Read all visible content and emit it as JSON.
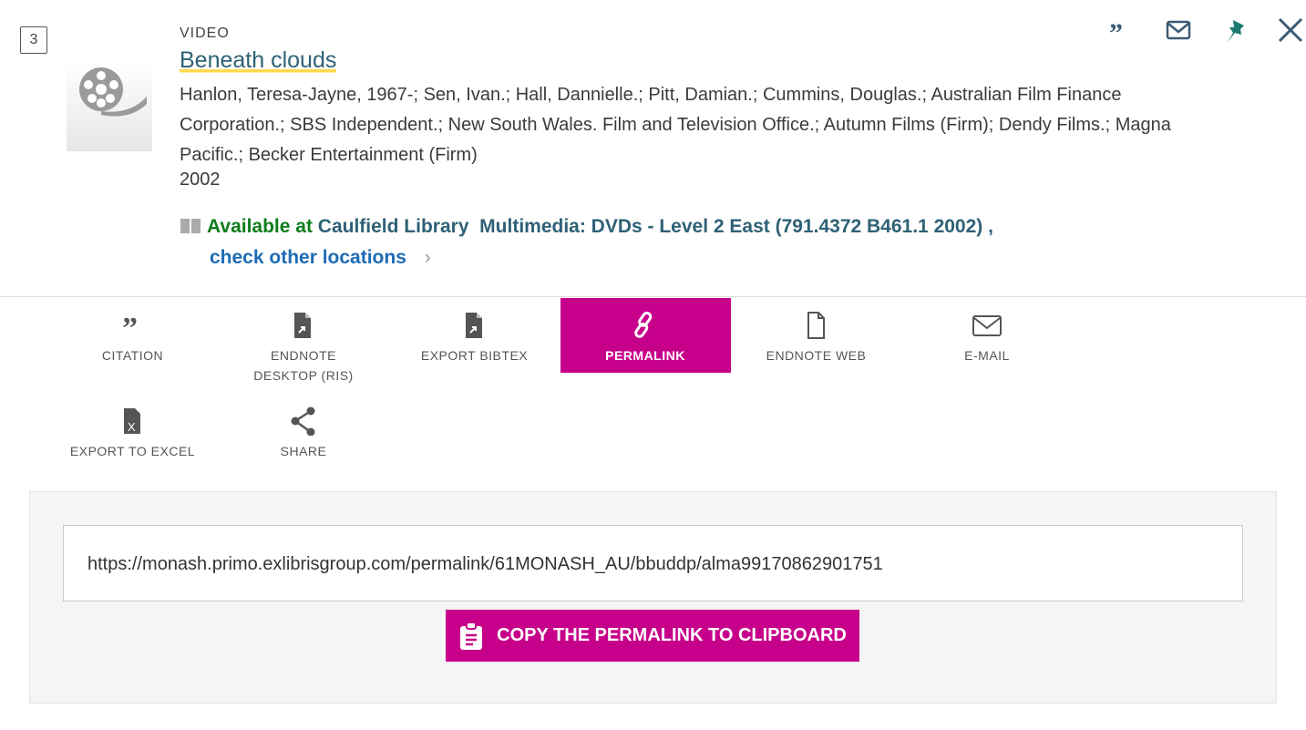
{
  "record": {
    "number": "3",
    "type": "VIDEO",
    "title": "Beneath clouds",
    "authors": "Hanlon, Teresa-Jayne, 1967-; Sen, Ivan.; Hall, Dannielle.; Pitt, Damian.; Cummins, Douglas.; Australian Film Finance Corporation.; SBS Independent.; New South Wales. Film and Television Office.; Autumn Films (Firm); Dendy Films.; Magna Pacific.; Becker Entertainment (Firm)",
    "year": "2002",
    "availability": {
      "status": "Available at",
      "library": "Caulfield Library",
      "location": "Multimedia: DVDs - Level 2 East (791.4372 B461.1 2002) ,",
      "other_locations": "check other locations"
    }
  },
  "header_icons": [
    "quote-icon",
    "mail-icon",
    "pin-icon",
    "close-icon"
  ],
  "actions": [
    {
      "label": "CITATION",
      "icon": "quote-icon"
    },
    {
      "label": "ENDNOTE DESKTOP (RIS)",
      "icon": "document-export-icon"
    },
    {
      "label": "EXPORT BIBTEX",
      "icon": "document-export-icon"
    },
    {
      "label": "PERMALINK",
      "icon": "link-icon",
      "active": true
    },
    {
      "label": "ENDNOTE WEB",
      "icon": "document-icon"
    },
    {
      "label": "E-MAIL",
      "icon": "mail-icon"
    },
    {
      "label": "EXPORT TO EXCEL",
      "icon": "excel-icon"
    },
    {
      "label": "SHARE",
      "icon": "share-icon"
    }
  ],
  "permalink": {
    "url": "https://monash.primo.exlibrisgroup.com/permalink/61MONASH_AU/bbuddp/alma99170862901751",
    "copy_label": "COPY THE PERMALINK TO CLIPBOARD"
  },
  "colors": {
    "accent": "#c7008b",
    "title": "#2e6176",
    "available": "#0e7d1b",
    "pin": "#1a7a70"
  }
}
